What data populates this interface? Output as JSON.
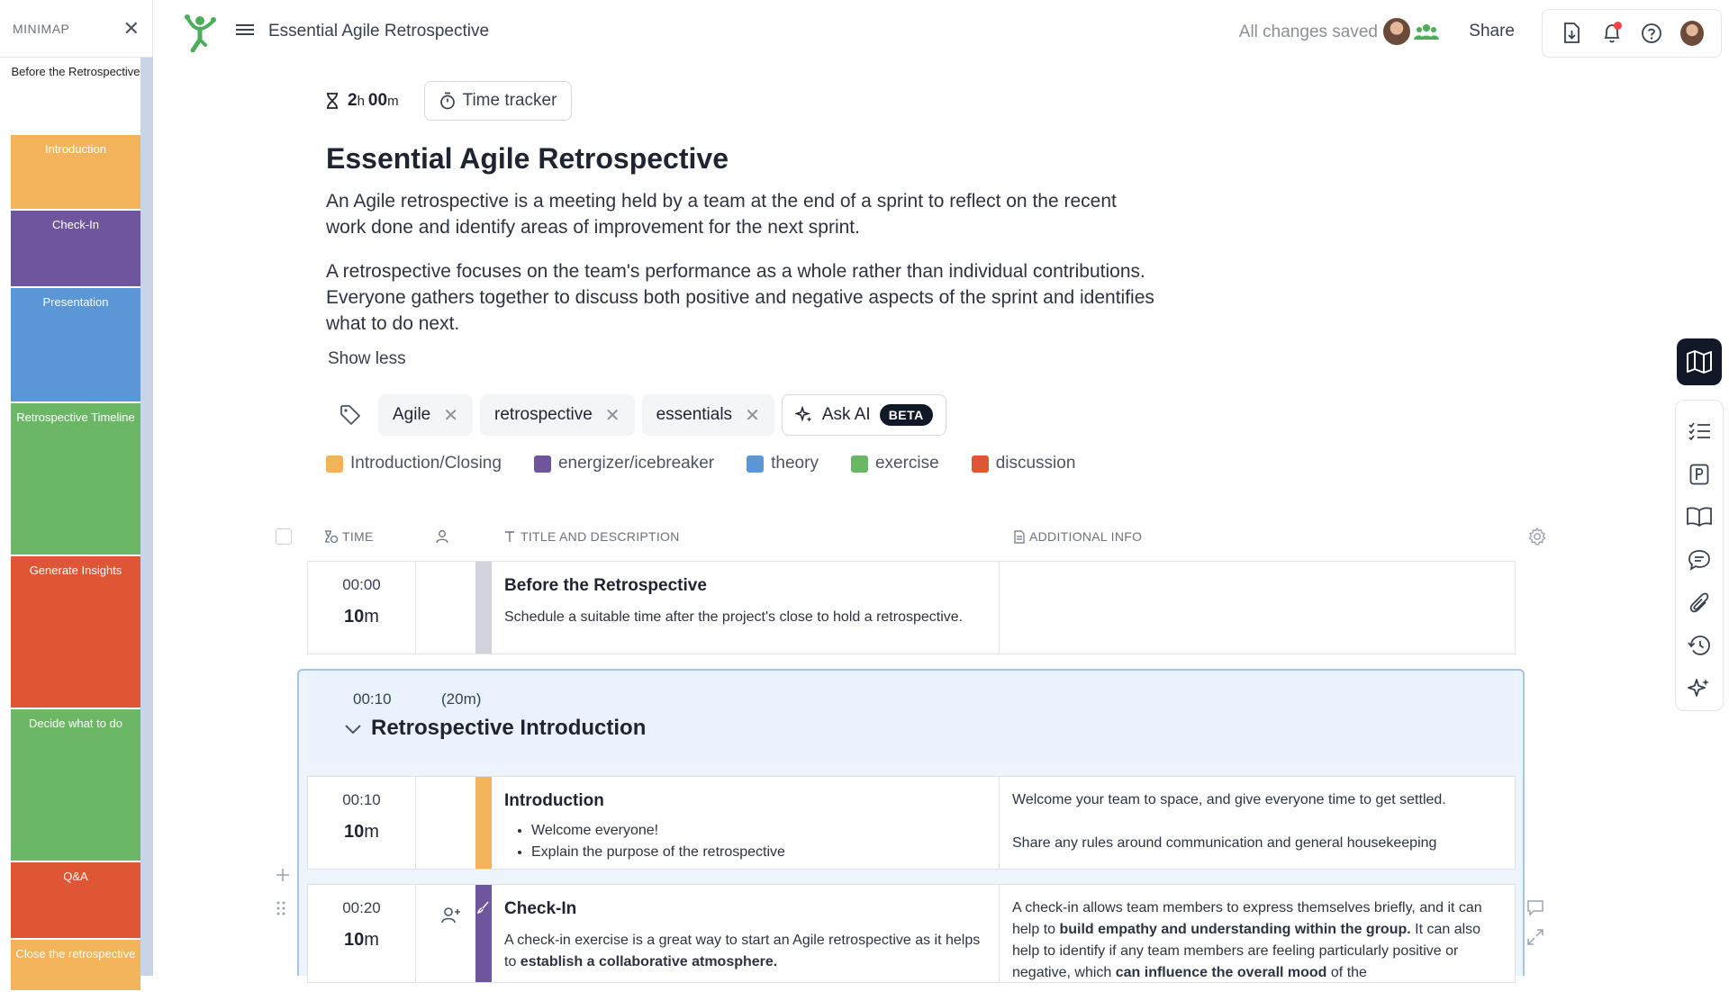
{
  "minimap": {
    "title": "MINIMAP",
    "items": [
      {
        "label": "Before the Retrospective",
        "color": "#ffffff",
        "light": true
      },
      {
        "label": "Introduction",
        "color": "#f2b35a",
        "light": false
      },
      {
        "label": "Check-In",
        "color": "#6f559c",
        "light": false
      },
      {
        "label": "Presentation",
        "color": "#5b96d6",
        "light": false
      },
      {
        "label": "Retrospective Timeline",
        "color": "#6cb766",
        "light": false
      },
      {
        "label": "Generate Insights",
        "color": "#df5634",
        "light": false
      },
      {
        "label": "Decide what to do",
        "color": "#6cb766",
        "light": false
      },
      {
        "label": "Q&A",
        "color": "#df5634",
        "light": false
      },
      {
        "label": "Close the retrospective",
        "color": "#f2b35a",
        "light": false
      }
    ]
  },
  "topbar": {
    "doc_title": "Essential Agile Retrospective",
    "saved_status": "All changes saved",
    "share_label": "Share"
  },
  "main": {
    "duration_hours": "2",
    "duration_h_unit": "h",
    "duration_minutes": "00",
    "duration_m_unit": "m",
    "time_tracker_label": "Time tracker",
    "title": "Essential Agile Retrospective",
    "description_1": "An Agile retrospective is a meeting held by a team at the end of a sprint to reflect on the recent work done and identify areas of improvement for the next sprint.",
    "description_2": "A retrospective focuses on the team's performance as a whole rather than individual contributions. Everyone gathers together to discuss both positive and negative aspects of the sprint and identifies what to do next.",
    "show_less": "Show less",
    "tags": [
      "Agile",
      "retrospective",
      "essentials"
    ],
    "ask_ai_label": "Ask AI",
    "ask_ai_badge": "BETA",
    "legend": [
      {
        "label": "Introduction/Closing",
        "color": "#f2b35a"
      },
      {
        "label": "energizer/icebreaker",
        "color": "#6f559c"
      },
      {
        "label": "theory",
        "color": "#5b96d6"
      },
      {
        "label": "exercise",
        "color": "#6cb766"
      },
      {
        "label": "discussion",
        "color": "#df5634"
      }
    ]
  },
  "table": {
    "col_time": "TIME",
    "col_title": "TITLE AND DESCRIPTION",
    "col_info": "ADDITIONAL INFO"
  },
  "rows": {
    "before": {
      "start": "00:00",
      "dur_num": "10",
      "dur_unit": "m",
      "title": "Before the Retrospective",
      "desc": "Schedule a suitable time after the project's close to hold a retrospective.",
      "bar_color": "#d1d5db"
    },
    "section": {
      "start": "00:10",
      "duration": "(20m)",
      "title": "Retrospective Introduction"
    },
    "intro": {
      "start": "00:10",
      "dur_num": "10",
      "dur_unit": "m",
      "title": "Introduction",
      "bullets": [
        "Welcome everyone!",
        "Explain the purpose of the retrospective"
      ],
      "info_1": "Welcome your team to space, and give everyone time to get settled.",
      "info_2": "Share any rules around communication and general housekeeping",
      "bar_color": "#f2b35a"
    },
    "checkin": {
      "start": "00:20",
      "dur_num": "10",
      "dur_unit": "m",
      "title": "Check-In",
      "desc_pre": "A check-in exercise is a great way to start an Agile retrospective as it helps to ",
      "desc_bold": "establish a collaborative atmosphere.",
      "info_pre": "A check-in allows team members to express themselves briefly, and it can help to ",
      "info_bold_1": "build empathy and understanding within the group.",
      "info_mid": " It can also help to identify if any team members are feeling particularly positive or negative, which ",
      "info_bold_2": "can influence the overall mood",
      "info_post": " of the",
      "bar_color": "#6f559c"
    }
  }
}
